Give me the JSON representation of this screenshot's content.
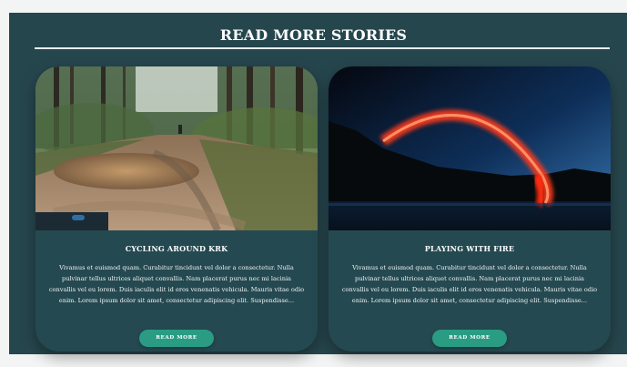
{
  "section": {
    "heading": "READ MORE STORIES"
  },
  "cards": [
    {
      "title": "CYCLING AROUND KRK",
      "body": "Vivamus et euismod quam. Curabitur tincidunt vel dolor a consectetur. Nulla pulvinar tellus ultrices aliquet convallis. Nam placerat purus nec mi lacinia convallis vel eu lorem. Duis iaculis elit id eros venenatis vehicula. Mauris vitae odio enim. Lorem ipsum dolor sit amet, consectetur adipiscing elit. Suspendisse...",
      "button_label": "READ MORE",
      "image": "muddy forest trail photo"
    },
    {
      "title": "PLAYING WITH FIRE",
      "body": "Vivamus et euismod quam. Curabitur tincidunt vel dolor a consectetur. Nulla pulvinar tellus ultrices aliquet convallis. Nam placerat purus nec mi lacinia convallis vel eu lorem. Duis iaculis elit id eros venenatis vehicula. Mauris vitae odio enim. Lorem ipsum dolor sit amet, consectetur adipiscing elit. Suspendisse...",
      "button_label": "READ MORE",
      "image": "fire arc night lake photo"
    }
  ],
  "colors": {
    "page_background": "#f3f4f4",
    "section_background": "#26464d",
    "card_background": "#254951",
    "button": "#2a9c83",
    "text": "#ffffff"
  }
}
